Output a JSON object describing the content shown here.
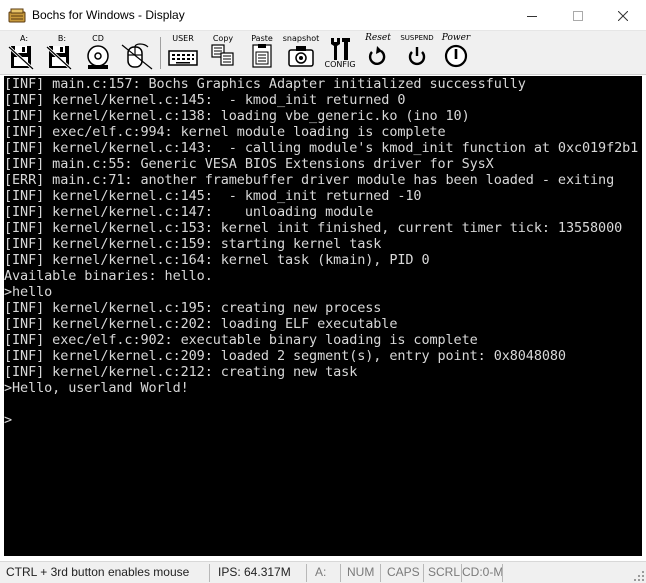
{
  "window": {
    "title": "Bochs for Windows - Display",
    "icon": "bochs-app-icon",
    "controls": [
      "minimize-icon",
      "maximize-icon",
      "close-icon"
    ]
  },
  "toolbar": {
    "floppy_a": "A:",
    "floppy_b": "B:",
    "cdrom": "CD",
    "user": "USER",
    "copy": "Copy",
    "paste": "Paste",
    "snapshot": "snapshot",
    "config": "CONFIG",
    "reset": "Reset",
    "suspend": "SUSPEND",
    "power": "Power"
  },
  "console": {
    "lines": [
      "[INF] main.c:157: Bochs Graphics Adapter initialized successfully",
      "[INF] kernel/kernel.c:145:  - kmod_init returned 0",
      "[INF] kernel/kernel.c:138: loading vbe_generic.ko (ino 10)",
      "[INF] exec/elf.c:994: kernel module loading is complete",
      "[INF] kernel/kernel.c:143:  - calling module's kmod_init function at 0xc019f2b1",
      "[INF] main.c:55: Generic VESA BIOS Extensions driver for SysX",
      "[ERR] main.c:71: another framebuffer driver module has been loaded - exiting",
      "[INF] kernel/kernel.c:145:  - kmod_init returned -10",
      "[INF] kernel/kernel.c:147:    unloading module",
      "[INF] kernel/kernel.c:153: kernel init finished, current timer tick: 13558000",
      "[INF] kernel/kernel.c:159: starting kernel task",
      "[INF] kernel/kernel.c:164: kernel task (kmain), PID 0",
      "Available binaries: hello.",
      ">hello",
      "[INF] kernel/kernel.c:195: creating new process",
      "[INF] kernel/kernel.c:202: loading ELF executable",
      "[INF] exec/elf.c:902: executable binary loading is complete",
      "[INF] kernel/kernel.c:209: loaded 2 segment(s), entry point: 0x8048080",
      "[INF] kernel/kernel.c:212: creating new task",
      ">Hello, userland World!",
      "",
      ">"
    ]
  },
  "statusbar": {
    "hint": "CTRL + 3rd button enables mouse",
    "ips": "IPS: 64.317M",
    "drive": "A:",
    "num": "NUM",
    "caps": "CAPS",
    "scrl": "SCRL",
    "cd": "CD:0-M"
  }
}
